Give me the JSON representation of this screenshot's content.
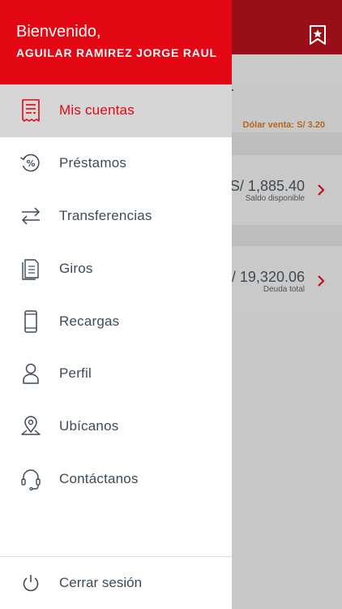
{
  "background": {
    "dolar_venta": "Dólar venta: S/ 3.20",
    "accounts": [
      {
        "amount": "S/ 1,885.40",
        "label": "Saldo disponible"
      },
      {
        "amount": "/ 19,320.06",
        "label": "Deuda total"
      }
    ]
  },
  "drawer": {
    "welcome": "Bienvenido,",
    "user_name": "AGUILAR RAMIREZ JORGE RAUL",
    "menu": [
      {
        "label": "Mis cuentas",
        "icon": "receipt-icon",
        "active": true
      },
      {
        "label": "Préstamos",
        "icon": "percent-refresh-icon"
      },
      {
        "label": "Transferencias",
        "icon": "transfer-arrows-icon"
      },
      {
        "label": "Giros",
        "icon": "document-icon"
      },
      {
        "label": "Recargas",
        "icon": "mobile-phone-icon"
      },
      {
        "label": "Perfil",
        "icon": "user-icon"
      },
      {
        "label": "Ubícanos",
        "icon": "location-pin-icon"
      },
      {
        "label": "Contáctanos",
        "icon": "headset-icon"
      }
    ],
    "logout": "Cerrar sesión"
  },
  "colors": {
    "brand_red": "#e30613",
    "dimmed_header": "#9a0e18",
    "text": "#3d4a57"
  }
}
